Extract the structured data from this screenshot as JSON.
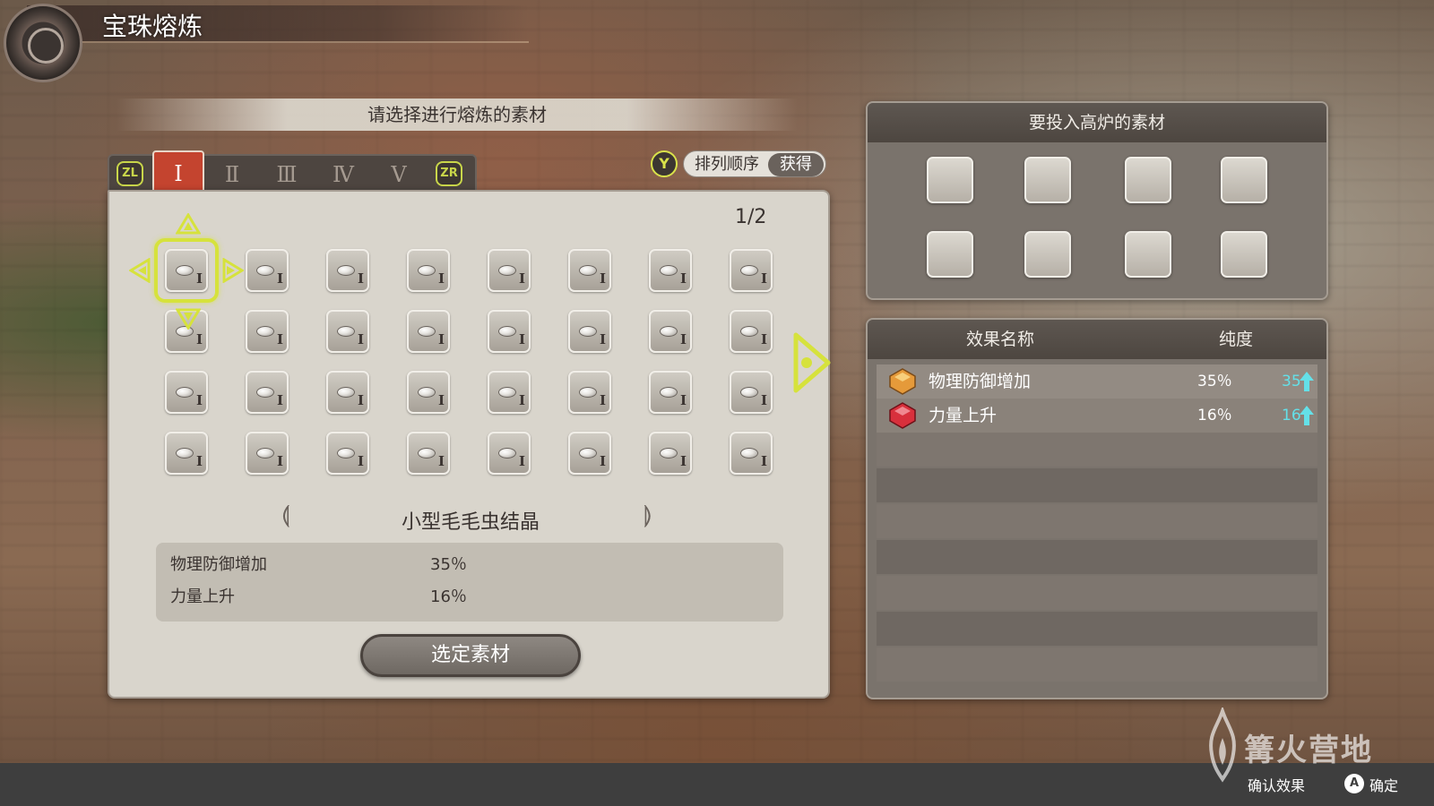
{
  "header": {
    "title": "宝珠熔炼"
  },
  "prompt": "请选择进行熔炼的素材",
  "tabs": {
    "left_button": "ZL",
    "right_button": "ZR",
    "items": [
      "Ⅰ",
      "Ⅱ",
      "Ⅲ",
      "Ⅳ",
      "Ⅴ"
    ],
    "active_index": 0
  },
  "sort": {
    "button": "Y",
    "label": "排列顺序",
    "value": "获得"
  },
  "page_indicator": "1/2",
  "grid": {
    "rows": 4,
    "cols": 8,
    "item_rank": "I",
    "selected_index": 0
  },
  "item_detail": {
    "name": "小型毛毛虫结晶",
    "effects": [
      {
        "name": "物理防御增加",
        "value": "35％"
      },
      {
        "name": "力量上升",
        "value": "16％"
      }
    ]
  },
  "select_button": "选定素材",
  "furnace": {
    "title": "要投入高炉的素材",
    "slot_count": 8
  },
  "effects_panel": {
    "col_name": "效果名称",
    "col_purity": "纯度",
    "rows": [
      {
        "icon": "orange-gem-icon",
        "name": "物理防御增加",
        "purity": "35％",
        "new_value": "35"
      },
      {
        "icon": "red-gem-icon",
        "name": "力量上升",
        "purity": "16％",
        "new_value": "16"
      }
    ],
    "empty_rows": 7
  },
  "footer": {
    "hint1": "确认效果",
    "hint2_button": "A",
    "hint2": "确定"
  },
  "watermark": "篝火营地",
  "colors": {
    "accent_yellow": "#d6e23c",
    "tab_active": "#c4442f",
    "purity_up": "#64e0e8",
    "orange_gem": "#e59a3a",
    "red_gem": "#d8303c"
  }
}
